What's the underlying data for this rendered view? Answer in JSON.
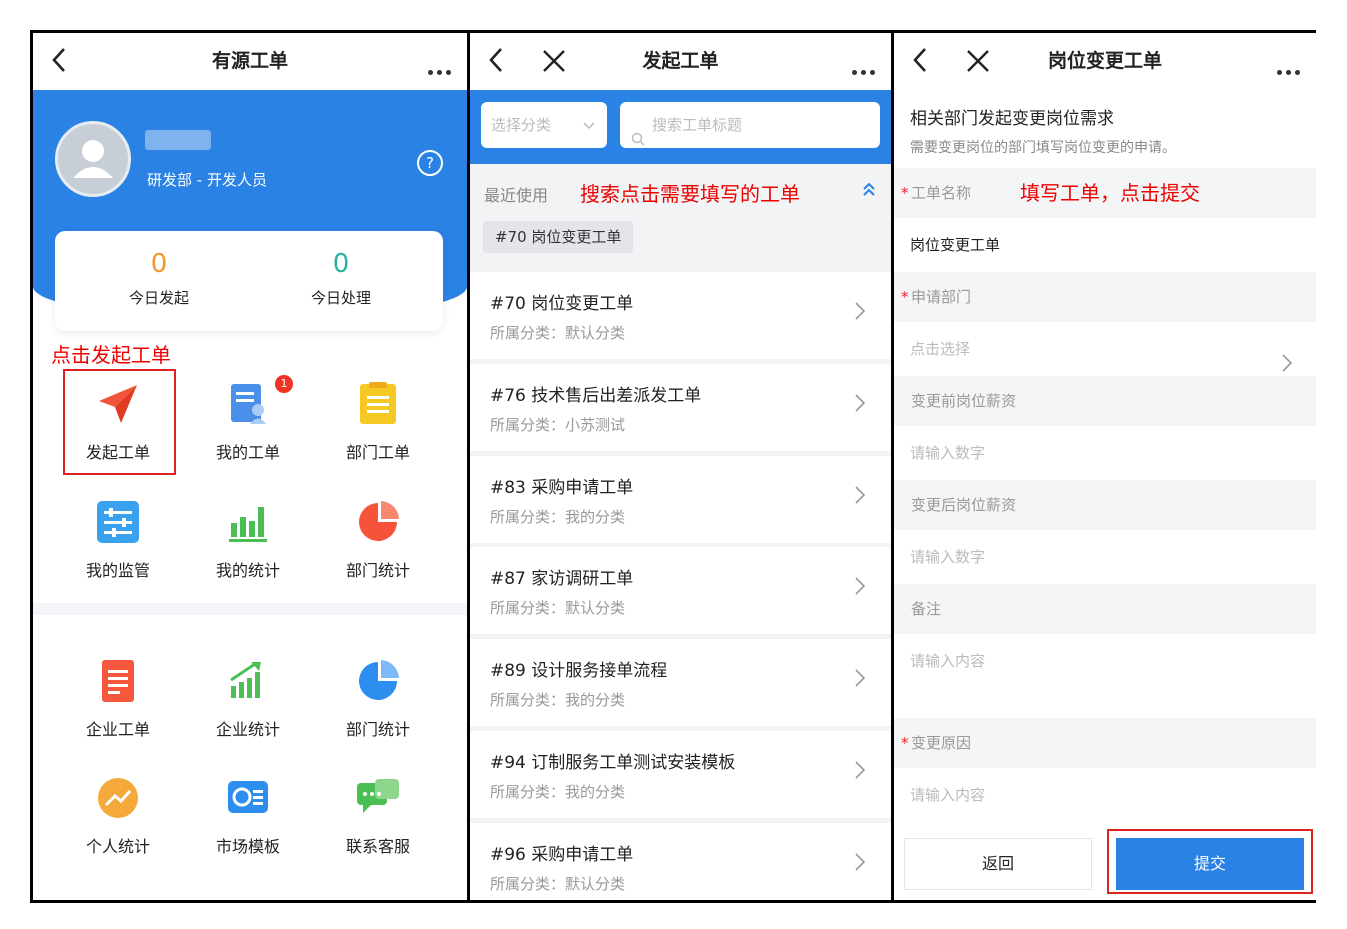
{
  "panel1": {
    "title": "有源工单",
    "dept": "研发部 - 开发人员",
    "help_icon": "?",
    "stats": [
      {
        "value": "0",
        "label": "今日发起",
        "color": "#f0982b"
      },
      {
        "value": "0",
        "label": "今日处理",
        "color": "#2bb3a3"
      }
    ],
    "annotation": "点击发起工单",
    "grid1": [
      {
        "label": "发起工单",
        "icon": "paper-plane-icon"
      },
      {
        "label": "我的工单",
        "icon": "my-workorder-icon",
        "badge": "1"
      },
      {
        "label": "部门工单",
        "icon": "clipboard-icon"
      },
      {
        "label": "我的监管",
        "icon": "sliders-icon"
      },
      {
        "label": "我的统计",
        "icon": "bar-chart-icon"
      },
      {
        "label": "部门统计",
        "icon": "pie-chart-icon"
      }
    ],
    "grid2": [
      {
        "label": "企业工单",
        "icon": "document-icon"
      },
      {
        "label": "企业统计",
        "icon": "growth-chart-icon"
      },
      {
        "label": "部门统计",
        "icon": "pie-chart-icon"
      },
      {
        "label": "个人统计",
        "icon": "trend-icon"
      },
      {
        "label": "市场模板",
        "icon": "template-icon"
      },
      {
        "label": "联系客服",
        "icon": "chat-icon"
      }
    ]
  },
  "panel2": {
    "title": "发起工单",
    "category_placeholder": "选择分类",
    "search_placeholder": "搜索工单标题",
    "recent_label": "最近使用",
    "annotation": "搜索点击需要填写的工单",
    "recent_chip": "#70  岗位变更工单",
    "orders": [
      {
        "title": "#70  岗位变更工单",
        "category": "所属分类：默认分类"
      },
      {
        "title": "#76  技术售后出差派发工单",
        "category": "所属分类：小苏测试"
      },
      {
        "title": "#83  采购申请工单",
        "category": "所属分类：我的分类"
      },
      {
        "title": "#87  家访调研工单",
        "category": "所属分类：默认分类"
      },
      {
        "title": "#89  设计服务接单流程",
        "category": "所属分类：我的分类"
      },
      {
        "title": "#94  订制服务工单测试安装模板",
        "category": "所属分类：我的分类"
      },
      {
        "title": "#96  采购申请工单",
        "category": "所属分类：默认分类"
      }
    ]
  },
  "panel3": {
    "title": "岗位变更工单",
    "heading": "相关部门发起变更岗位需求",
    "description": "需要变更岗位的部门填写岗位变更的申请。",
    "annotation": "填写工单，点击提交",
    "fields": {
      "name_label": "工单名称",
      "name_value": "岗位变更工单",
      "dept_label": "申请部门",
      "dept_placeholder": "点击选择",
      "salary_before_label": "变更前岗位薪资",
      "salary_before_placeholder": "请输入数字",
      "salary_after_label": "变更后岗位薪资",
      "salary_after_placeholder": "请输入数字",
      "remark_label": "备注",
      "remark_placeholder": "请输入内容",
      "reason_label": "变更原因",
      "reason_placeholder": "请输入内容"
    },
    "back_label": "返回",
    "submit_label": "提交"
  },
  "colors": {
    "primary": "#2a82e4",
    "annotation": "#e00000",
    "required": "#e22222"
  }
}
